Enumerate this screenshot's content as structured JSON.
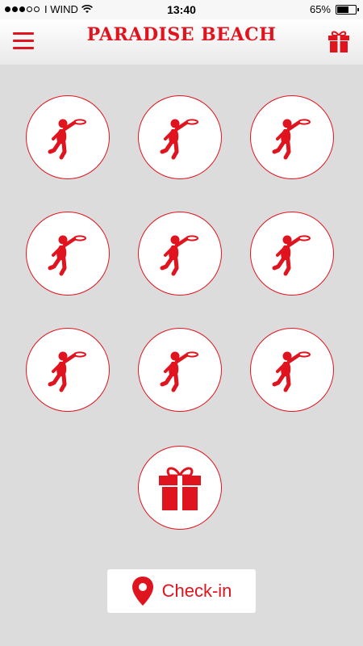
{
  "status": {
    "carrier": "I WIND",
    "time": "13:40",
    "battery": "65%",
    "battery_level": 0.65
  },
  "header": {
    "title": "PARADISE BEACH"
  },
  "stamps": [
    {
      "icon": "frisbee-player-icon"
    },
    {
      "icon": "frisbee-player-icon"
    },
    {
      "icon": "frisbee-player-icon"
    },
    {
      "icon": "frisbee-player-icon"
    },
    {
      "icon": "frisbee-player-icon"
    },
    {
      "icon": "frisbee-player-icon"
    },
    {
      "icon": "frisbee-player-icon"
    },
    {
      "icon": "frisbee-player-icon"
    },
    {
      "icon": "frisbee-player-icon"
    }
  ],
  "reward": {
    "icon": "gift-icon"
  },
  "checkin": {
    "label": "Check-in",
    "icon": "location-pin-icon"
  },
  "colors": {
    "accent": "#e0141e",
    "background": "#dcdcdc"
  }
}
